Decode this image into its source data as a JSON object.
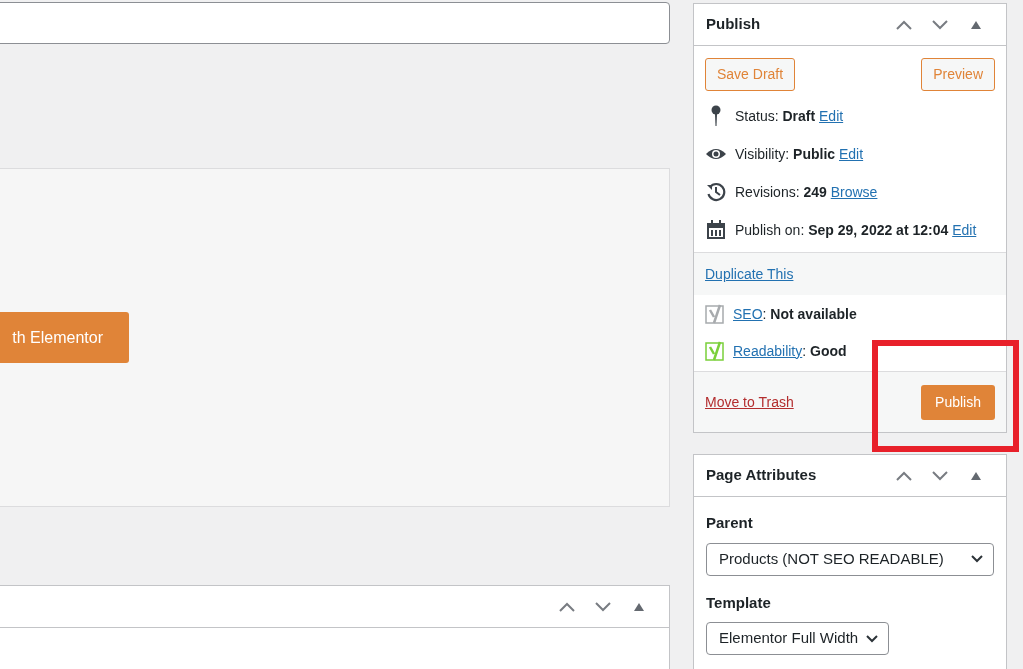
{
  "editor": {
    "elementor_button": "th Elementor"
  },
  "publish_box": {
    "title": "Publish",
    "actions": [
      {
        "label": "Save Draft"
      },
      {
        "label": "Preview"
      }
    ],
    "rows": [
      {
        "kind": "status",
        "label": "Status:",
        "value": "Draft",
        "link": "Edit"
      },
      {
        "kind": "visibility",
        "label": "Visibility:",
        "value": "Public",
        "link": "Edit"
      },
      {
        "kind": "revisions",
        "label": "Revisions:",
        "value": "249",
        "link": "Browse"
      },
      {
        "kind": "schedule",
        "label": "Publish on:",
        "value": "Sep 29, 2022 at 12:04",
        "link": "Edit"
      }
    ],
    "duplicate_link": "Duplicate This",
    "seo_rows": [
      {
        "link": "SEO",
        "separator": ":",
        "value": "Not available",
        "color": "#a7aaad"
      },
      {
        "link": "Readability",
        "separator": ":",
        "value": "Good",
        "color": "#7ad03a"
      }
    ],
    "trash_link": "Move to Trash",
    "publish_button": "Publish"
  },
  "page_attributes": {
    "title": "Page Attributes",
    "fields": [
      {
        "label": "Parent",
        "value": "Products (NOT SEO READABLE)"
      },
      {
        "label": "Template",
        "value": "Elementor Full Width"
      }
    ]
  }
}
